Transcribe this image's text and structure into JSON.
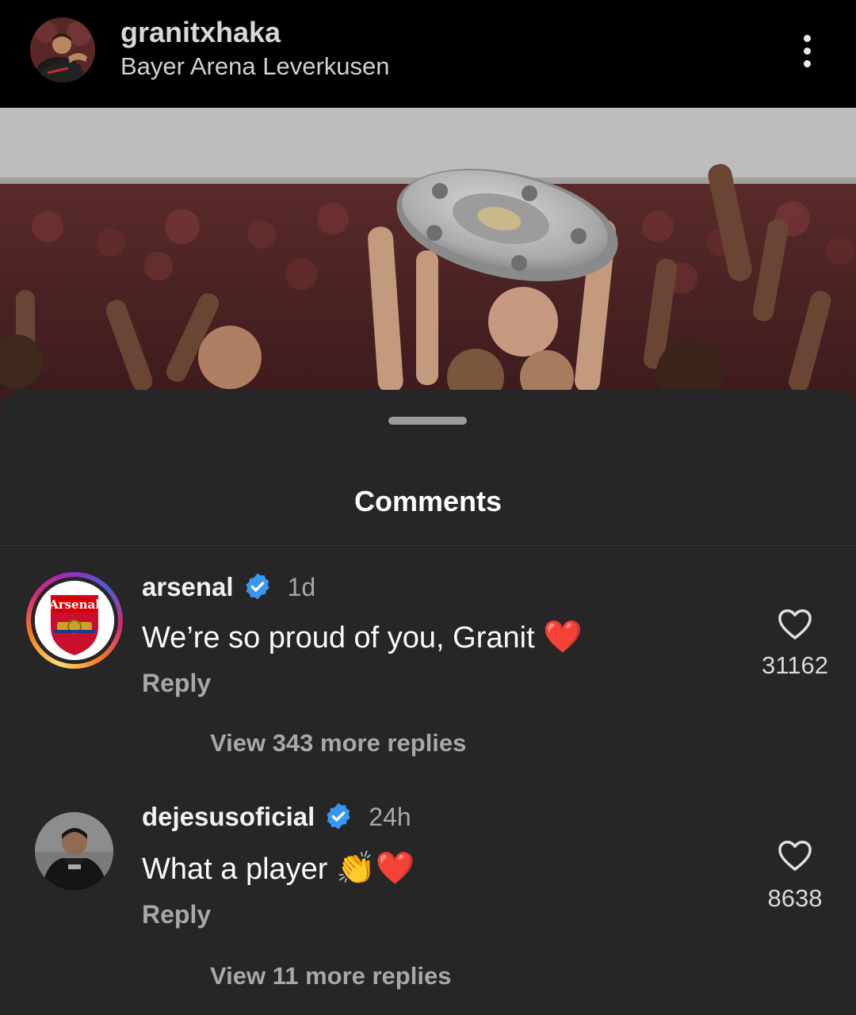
{
  "post_header": {
    "username": "granitxhaka",
    "location": "Bayer Arena Leverkusen"
  },
  "comments_sheet": {
    "title": "Comments",
    "comments": [
      {
        "username": "arsenal",
        "verified": true,
        "time": "1d",
        "text": "We’re so proud of you, Granit",
        "emoji": "❤️",
        "reply_label": "Reply",
        "view_replies": "View 343 more replies",
        "like_count": "31162",
        "avatar_badge_text": "Arsenal"
      },
      {
        "username": "dejesusoficial",
        "verified": true,
        "time": "24h",
        "text": "What a player",
        "emoji": "👏❤️",
        "reply_label": "Reply",
        "view_replies": "View 11 more replies",
        "like_count": "8638"
      }
    ]
  },
  "icons": {
    "more": "more-vertical-icon",
    "verified": "verified-badge-icon",
    "like": "heart-outline-icon"
  },
  "colors": {
    "sheet_bg": "#262626",
    "verified_blue": "#3897f0",
    "secondary_text": "#a8a8a8"
  }
}
